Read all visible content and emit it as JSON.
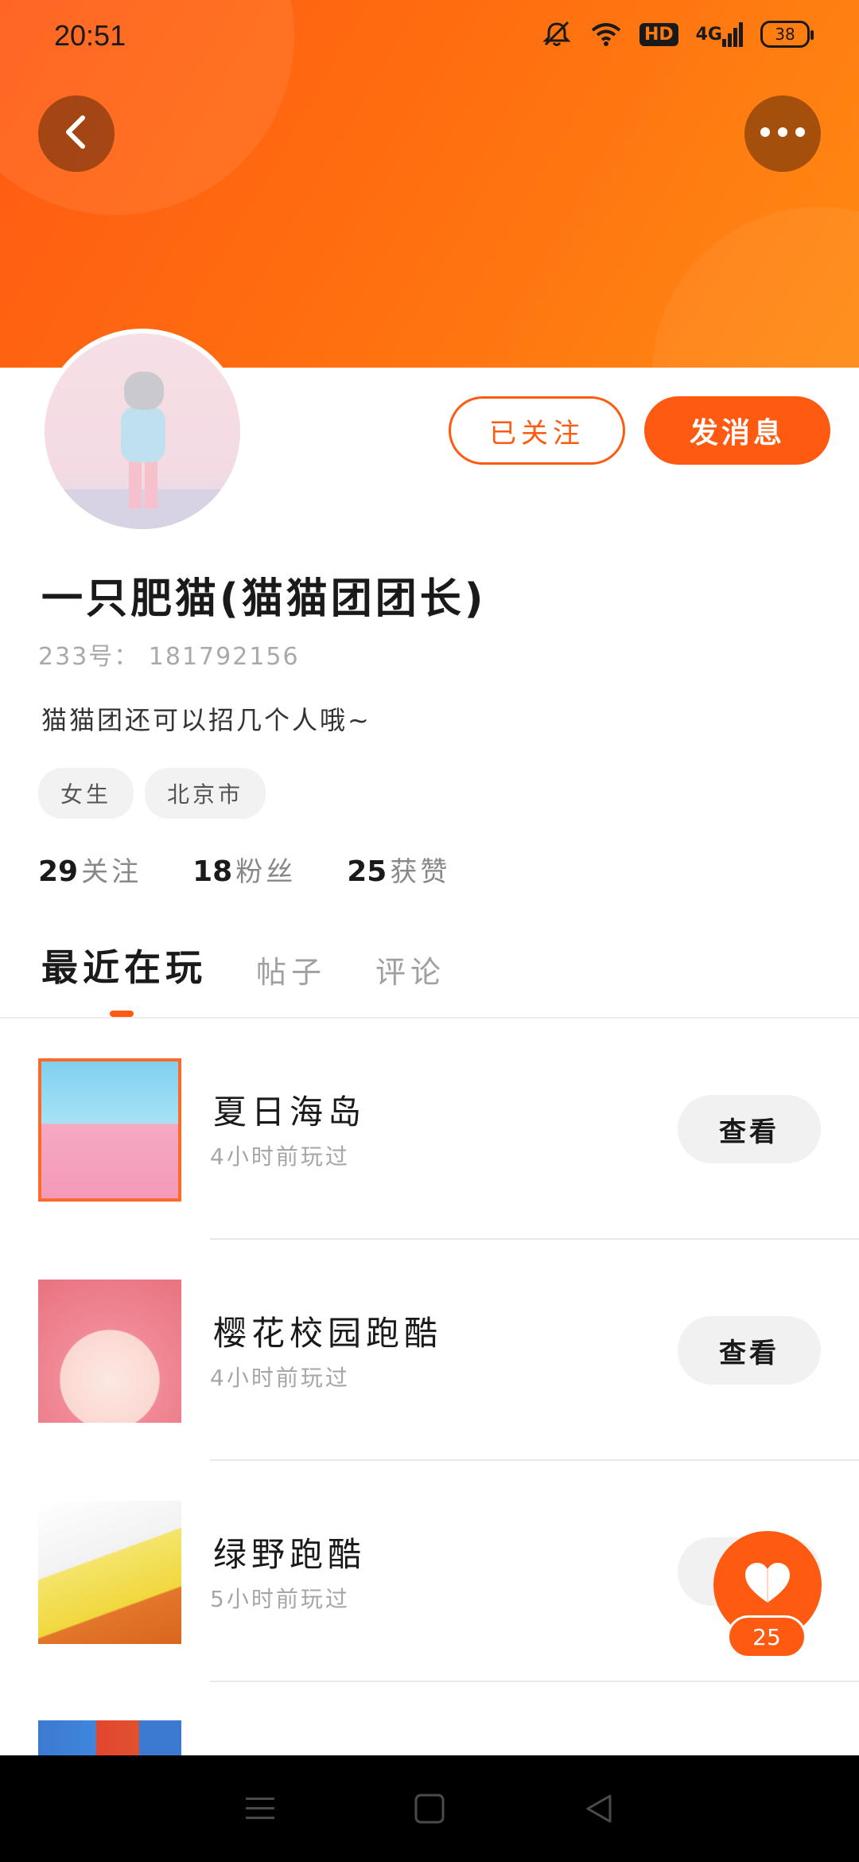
{
  "status_bar": {
    "time": "20:51",
    "hd_label": "HD",
    "network_label": "4G",
    "battery": "38"
  },
  "header": {
    "back_icon": "chevron-left-icon",
    "more_icon": "more-dots-icon",
    "accent_color": "#ff5a12"
  },
  "profile": {
    "nickname": "一只肥猫(猫猫团团长)",
    "uid": "233号： 181792156",
    "bio": "猫猫团还可以招几个人哦~",
    "tags": [
      "女生",
      "北京市"
    ],
    "follow_button": "已关注",
    "message_button": "发消息",
    "stats": [
      {
        "num": "29",
        "label": "关注"
      },
      {
        "num": "18",
        "label": "粉丝"
      },
      {
        "num": "25",
        "label": "获赞"
      }
    ]
  },
  "tabs": [
    {
      "label": "最近在玩",
      "active": true
    },
    {
      "label": "帖子",
      "active": false
    },
    {
      "label": "评论",
      "active": false
    }
  ],
  "games": [
    {
      "title": "夏日海岛",
      "sub": "4小时前玩过",
      "button": "查看"
    },
    {
      "title": "樱花校园跑酷",
      "sub": "4小时前玩过",
      "button": "查看"
    },
    {
      "title": "绿野跑酷",
      "sub": "5小时前玩过",
      "button": "查看"
    }
  ],
  "like": {
    "count": "25",
    "icon": "heart-icon"
  },
  "navbar": {
    "menu_icon": "menu-icon",
    "home_icon": "home-square-icon",
    "back_icon": "back-triangle-icon"
  }
}
